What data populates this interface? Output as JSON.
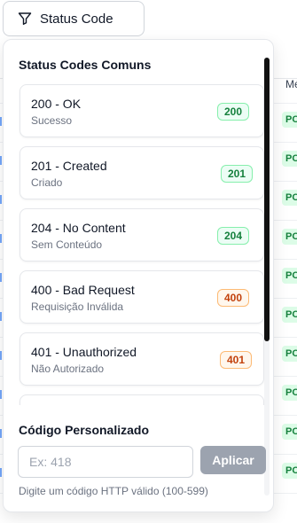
{
  "filter_button": {
    "label": "Status Code",
    "icon": "filter-icon"
  },
  "background_table": {
    "header_partial": "Mét",
    "badge_partial": "POST"
  },
  "popover": {
    "common_title": "Status Codes Comuns",
    "items": [
      {
        "title": "200 - OK",
        "subtitle": "Sucesso",
        "badge": "200",
        "tone": "success"
      },
      {
        "title": "201 - Created",
        "subtitle": "Criado",
        "badge": "201",
        "tone": "success"
      },
      {
        "title": "204 - No Content",
        "subtitle": "Sem Conteúdo",
        "badge": "204",
        "tone": "success"
      },
      {
        "title": "400 - Bad Request",
        "subtitle": "Requisição Inválida",
        "badge": "400",
        "tone": "client-error"
      },
      {
        "title": "401 - Unauthorized",
        "subtitle": "Não Autorizado",
        "badge": "401",
        "tone": "client-error"
      }
    ],
    "custom_title": "Código Personalizado",
    "custom_input": {
      "value": "",
      "placeholder": "Ex: 418"
    },
    "apply_label": "Aplicar",
    "hint": "Digite um código HTTP válido (100-599)"
  },
  "colors": {
    "success_text": "#15803d",
    "success_bg": "#ecfdf5",
    "client_error_text": "#c2410c",
    "client_error_bg": "#fff7ed",
    "apply_button_bg": "#9ca3af"
  }
}
